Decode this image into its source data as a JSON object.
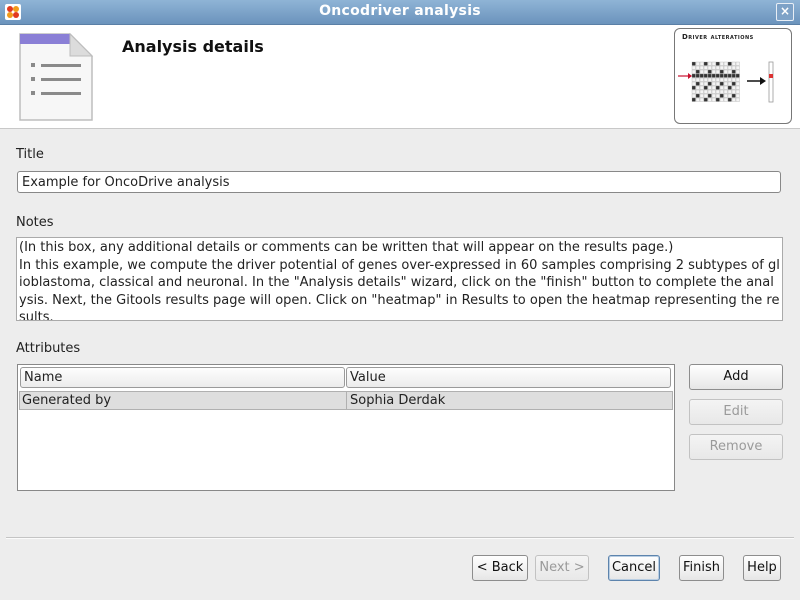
{
  "window": {
    "title": "Oncodriver analysis",
    "close_symbol": "×"
  },
  "header": {
    "title": "Analysis details",
    "thumbnail_title": "Driver alterations"
  },
  "form": {
    "title_label": "Title",
    "title_value": "Example for OncoDrive analysis",
    "notes_label": "Notes",
    "notes_value": "(In this box, any additional details or comments can be written that will appear on the results page.)\nIn this example, we compute the driver potential of genes over-expressed in 60 samples comprising 2 subtypes of glioblastoma, classical and neuronal. In the \"Analysis details\" wizard, click on the \"finish\" button to complete the analysis. Next, the Gitools results page will open. Click on \"heatmap\" in Results to open the heatmap representing the results.",
    "attributes_label": "Attributes"
  },
  "attributes_table": {
    "columns": [
      "Name",
      "Value"
    ],
    "rows": [
      {
        "name": "Generated by",
        "value": "Sophia Derdak"
      }
    ]
  },
  "attribute_buttons": {
    "add": "Add",
    "edit": "Edit",
    "remove": "Remove"
  },
  "footer": {
    "back": "< Back",
    "next": "Next >",
    "cancel": "Cancel",
    "finish": "Finish",
    "help": "Help"
  },
  "colors": {
    "titlebar": "#7ba2c8",
    "accent_red": "#c8102e",
    "heatmap_dark": "#333333"
  }
}
